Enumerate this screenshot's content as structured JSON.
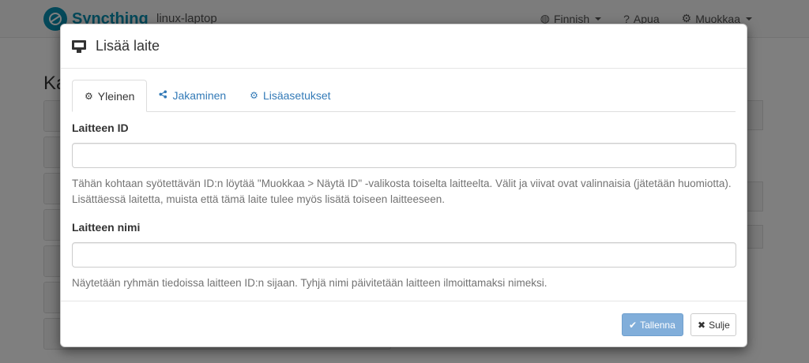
{
  "navbar": {
    "brand": "Syncthing",
    "hostname": "linux-laptop",
    "language": "Finnish",
    "help": "Apua",
    "actions": "Muokkaa"
  },
  "background": {
    "heading": "Ka"
  },
  "modal": {
    "title": "Lisää laite",
    "tabs": [
      {
        "label": "Yleinen",
        "icon": "gear-icon",
        "active": true
      },
      {
        "label": "Jakaminen",
        "icon": "share-icon",
        "active": false
      },
      {
        "label": "Lisäasetukset",
        "icon": "cogs-icon",
        "active": false
      }
    ],
    "device_id": {
      "label": "Laitteen ID",
      "value": "",
      "help": "Tähän kohtaan syötettävän ID:n löytää \"Muokkaa > Näytä ID\" -valikosta toiselta laitteelta. Välit ja viivat ovat valinnaisia (jätetään huomiotta). Lisättäessä laitetta, muista että tämä laite tulee myös lisätä toiseen laitteeseen."
    },
    "device_name": {
      "label": "Laitteen nimi",
      "value": "",
      "help": "Näytetään ryhmän tiedoissa laitteen ID:n sijaan. Tyhjä nimi päivitetään laitteen ilmoittamaksi nimeksi."
    },
    "footer": {
      "save_label": "Tallenna",
      "close_label": "Sulje"
    }
  }
}
